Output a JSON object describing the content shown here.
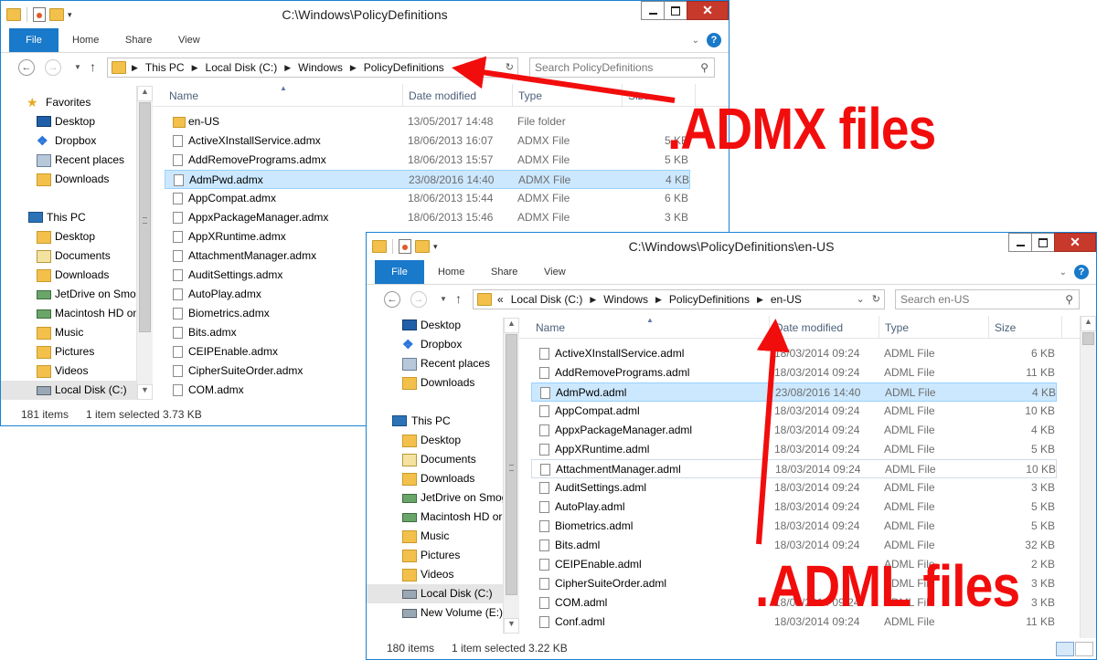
{
  "windows": {
    "admx": {
      "title": "C:\\Windows\\PolicyDefinitions",
      "ribbon_tabs": [
        "File",
        "Home",
        "Share",
        "View"
      ],
      "address": [
        "This PC",
        "Local Disk (C:)",
        "Windows",
        "PolicyDefinitions"
      ],
      "search_placeholder": "Search PolicyDefinitions",
      "nav": {
        "favorites_label": "Favorites",
        "favorites": [
          "Desktop",
          "Dropbox",
          "Recent places",
          "Downloads"
        ],
        "thispc_label": "This PC",
        "thispc": [
          "Desktop",
          "Documents",
          "Downloads",
          "JetDrive on Smog",
          "Macintosh HD on",
          "Music",
          "Pictures",
          "Videos",
          "Local Disk (C:)"
        ]
      },
      "columns": [
        "Name",
        "Date modified",
        "Type",
        "Size"
      ],
      "files": [
        {
          "name": "en-US",
          "date": "13/05/2017 14:48",
          "type": "File folder",
          "size": "",
          "folder": true
        },
        {
          "name": "ActiveXInstallService.admx",
          "date": "18/06/2013 16:07",
          "type": "ADMX File",
          "size": "5 KB"
        },
        {
          "name": "AddRemovePrograms.admx",
          "date": "18/06/2013 15:57",
          "type": "ADMX File",
          "size": "5 KB"
        },
        {
          "name": "AdmPwd.admx",
          "date": "23/08/2016 14:40",
          "type": "ADMX File",
          "size": "4 KB",
          "selected": true
        },
        {
          "name": "AppCompat.admx",
          "date": "18/06/2013 15:44",
          "type": "ADMX File",
          "size": "6 KB"
        },
        {
          "name": "AppxPackageManager.admx",
          "date": "18/06/2013 15:46",
          "type": "ADMX File",
          "size": "3 KB"
        },
        {
          "name": "AppXRuntime.admx",
          "date": "",
          "type": "",
          "size": ""
        },
        {
          "name": "AttachmentManager.admx",
          "date": "",
          "type": "",
          "size": ""
        },
        {
          "name": "AuditSettings.admx",
          "date": "",
          "type": "",
          "size": ""
        },
        {
          "name": "AutoPlay.admx",
          "date": "",
          "type": "",
          "size": ""
        },
        {
          "name": "Biometrics.admx",
          "date": "",
          "type": "",
          "size": ""
        },
        {
          "name": "Bits.admx",
          "date": "",
          "type": "",
          "size": ""
        },
        {
          "name": "CEIPEnable.admx",
          "date": "",
          "type": "",
          "size": ""
        },
        {
          "name": "CipherSuiteOrder.admx",
          "date": "",
          "type": "",
          "size": ""
        },
        {
          "name": "COM.admx",
          "date": "",
          "type": "",
          "size": ""
        }
      ],
      "status": {
        "count": "181 items",
        "selected": "1 item selected  3.73 KB"
      }
    },
    "adml": {
      "title": "C:\\Windows\\PolicyDefinitions\\en-US",
      "ribbon_tabs": [
        "File",
        "Home",
        "Share",
        "View"
      ],
      "address_prefix": "«",
      "address": [
        "Local Disk (C:)",
        "Windows",
        "PolicyDefinitions",
        "en-US"
      ],
      "search_placeholder": "Search en-US",
      "nav": {
        "favorites": [
          "Desktop",
          "Dropbox",
          "Recent places",
          "Downloads"
        ],
        "thispc_label": "This PC",
        "thispc": [
          "Desktop",
          "Documents",
          "Downloads",
          "JetDrive on Smog",
          "Macintosh HD or",
          "Music",
          "Pictures",
          "Videos",
          "Local Disk (C:)",
          "New Volume (E:)"
        ]
      },
      "columns": [
        "Name",
        "Date modified",
        "Type",
        "Size"
      ],
      "files": [
        {
          "name": "ActiveXInstallService.adml",
          "date": "18/03/2014 09:24",
          "type": "ADML File",
          "size": "6 KB"
        },
        {
          "name": "AddRemovePrograms.adml",
          "date": "18/03/2014 09:24",
          "type": "ADML File",
          "size": "11 KB"
        },
        {
          "name": "AdmPwd.adml",
          "date": "23/08/2016 14:40",
          "type": "ADML File",
          "size": "4 KB",
          "selected": true
        },
        {
          "name": "AppCompat.adml",
          "date": "18/03/2014 09:24",
          "type": "ADML File",
          "size": "10 KB"
        },
        {
          "name": "AppxPackageManager.adml",
          "date": "18/03/2014 09:24",
          "type": "ADML File",
          "size": "4 KB"
        },
        {
          "name": "AppXRuntime.adml",
          "date": "18/03/2014 09:24",
          "type": "ADML File",
          "size": "5 KB"
        },
        {
          "name": "AttachmentManager.adml",
          "date": "18/03/2014 09:24",
          "type": "ADML File",
          "size": "10 KB",
          "hover": true
        },
        {
          "name": "AuditSettings.adml",
          "date": "18/03/2014 09:24",
          "type": "ADML File",
          "size": "3 KB"
        },
        {
          "name": "AutoPlay.adml",
          "date": "18/03/2014 09:24",
          "type": "ADML File",
          "size": "5 KB"
        },
        {
          "name": "Biometrics.adml",
          "date": "18/03/2014 09:24",
          "type": "ADML File",
          "size": "5 KB"
        },
        {
          "name": "Bits.adml",
          "date": "18/03/2014 09:24",
          "type": "ADML File",
          "size": "32 KB"
        },
        {
          "name": "CEIPEnable.adml",
          "date": "",
          "type": "ADML File",
          "size": "2 KB"
        },
        {
          "name": "CipherSuiteOrder.adml",
          "date": "",
          "type": "ADML File",
          "size": "3 KB"
        },
        {
          "name": "COM.adml",
          "date": "18/03/2014 09:24",
          "type": "ADML File",
          "size": "3 KB"
        },
        {
          "name": "Conf.adml",
          "date": "18/03/2014 09:24",
          "type": "ADML File",
          "size": "11 KB"
        }
      ],
      "status": {
        "count": "180 items",
        "selected": "1 item selected  3.22 KB"
      }
    }
  },
  "annotations": {
    "admx_label": ".ADMX files",
    "adml_label": ".ADML files",
    "color": "#f20d0d"
  },
  "colors": {
    "accent": "#1979ca",
    "selection": "#cce8ff",
    "close": "#c7392b"
  }
}
